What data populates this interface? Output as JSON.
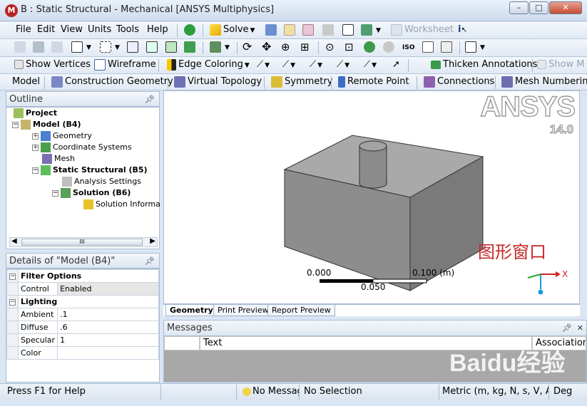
{
  "window": {
    "title": "B : Static Structural - Mechanical [ANSYS Multiphysics]",
    "minimize": "–",
    "maximize": "□",
    "close": "✕"
  },
  "menu": [
    "File",
    "Edit",
    "View",
    "Units",
    "Tools",
    "Help"
  ],
  "toolbar1": {
    "solve": "Solve",
    "worksheet": "Worksheet"
  },
  "toolbar3": {
    "show_vertices": "Show Vertices",
    "wireframe": "Wireframe",
    "edge_coloring": "Edge Coloring",
    "thicken_annotations": "Thicken Annotations",
    "show_mesh": "Show M"
  },
  "context_toolbar": {
    "model": "Model",
    "construction_geometry": "Construction Geometry",
    "virtual_topology": "Virtual Topology",
    "symmetry": "Symmetry",
    "remote_point": "Remote Point",
    "connections": "Connections",
    "mesh_numbering": "Mesh Numberin"
  },
  "outline": {
    "title": "Outline",
    "nodes": [
      {
        "label": "Project",
        "bold": true
      },
      {
        "label": "Model (B4)",
        "bold": true
      },
      {
        "label": "Geometry",
        "bold": false
      },
      {
        "label": "Coordinate Systems",
        "bold": false
      },
      {
        "label": "Mesh",
        "bold": false
      },
      {
        "label": "Static Structural (B5)",
        "bold": true
      },
      {
        "label": "Analysis Settings",
        "bold": false
      },
      {
        "label": "Solution (B6)",
        "bold": true
      },
      {
        "label": "Solution Informa",
        "bold": false
      }
    ],
    "scroll_grip": "III"
  },
  "details": {
    "title": "Details of \"Model (B4)\"",
    "groups": [
      {
        "name": "Filter Options",
        "rows": [
          {
            "key": "Control",
            "value": "Enabled"
          }
        ]
      },
      {
        "name": "Lighting",
        "rows": [
          {
            "key": "Ambient",
            "value": ".1"
          },
          {
            "key": "Diffuse",
            "value": ".6"
          },
          {
            "key": "Specular",
            "value": "1"
          },
          {
            "key": "Color",
            "value": ""
          }
        ]
      }
    ]
  },
  "viewport": {
    "logo": "ANSYS",
    "version": "14.0",
    "label": "图形窗口",
    "scale_left": "0.000",
    "scale_mid": "0.050",
    "scale_right": "0.100 (m)",
    "axis_x": "X"
  },
  "view_tabs": [
    "Geometry",
    "Print Preview",
    "Report Preview"
  ],
  "messages": {
    "title": "Messages",
    "col_text": "Text",
    "col_assoc": "Association"
  },
  "status": {
    "help": "Press F1 for Help",
    "messages": "No Messag",
    "selection": "No Selection",
    "units": "Metric (m, kg, N, s, V, A)",
    "angle": "Deg"
  },
  "watermark": "Baidu经验",
  "colors": {
    "accent": "#c62828",
    "chrome": "#dbe6f4",
    "solid": "#8c8c8c"
  }
}
